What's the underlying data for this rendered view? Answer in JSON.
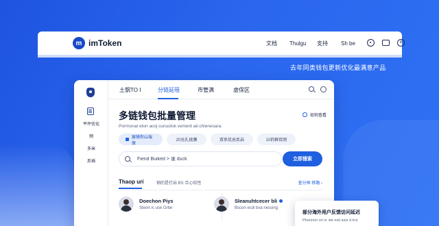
{
  "brand": {
    "name": "imToken",
    "mark": "m"
  },
  "top_nav": {
    "items": [
      "文档",
      "Thulgu",
      "支持",
      "Sh be"
    ]
  },
  "headline": "去年同类钱包更新优化最满意产品",
  "sidebar": {
    "items": [
      "平坪优化",
      "频",
      "多米",
      "反插"
    ]
  },
  "tabs": {
    "items": [
      "土钢TO Ⅰ",
      "分链延瑶",
      "市管满",
      "虚保区"
    ],
    "active": 1
  },
  "main": {
    "title": "多链钱包批量管理",
    "help": "如何查看",
    "description": "Pormonat eton acoj cunuolsk vement ak:chienesara.",
    "chips": [
      "展镜你山瑞保",
      "20允扎拢膜",
      "双系优总反启",
      "10的群目则"
    ]
  },
  "search": {
    "placeholder": "Fiend Buiked > 谁 duck",
    "button": "立即搜索"
  },
  "section": {
    "title": "Thaop uri",
    "subtitle": "钢的是打出 BS 合心较性",
    "more": "查分钟 移路"
  },
  "people": [
    {
      "name": "Doechon Piys",
      "sub": "Steon /c use Grbe"
    },
    {
      "name": "Sleanuhtcecer bli",
      "sub": "Bscon ecdi bxa nessing"
    }
  ],
  "float_card": {
    "title": "部分海外用户反馈访问延迟",
    "sub": "Pheonon crt nr ste esit asis d trur"
  },
  "colors": {
    "accent": "#1f5fe0",
    "background": "#2a66ee"
  }
}
